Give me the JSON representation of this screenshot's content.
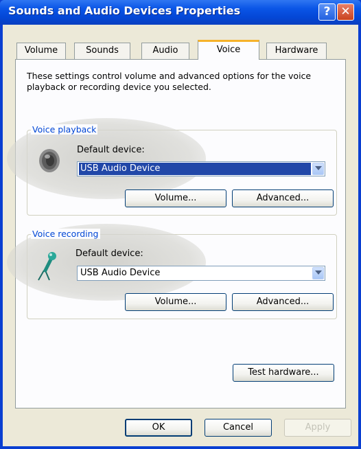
{
  "window": {
    "title": "Sounds and Audio Devices Properties"
  },
  "titlebar": {
    "help_label": "?",
    "close_label": "✕"
  },
  "tabs": [
    {
      "label": "Volume"
    },
    {
      "label": "Sounds"
    },
    {
      "label": "Audio"
    },
    {
      "label": "Voice",
      "active": true
    },
    {
      "label": "Hardware"
    }
  ],
  "description": "These settings control volume and advanced options for the voice playback or recording device you selected.",
  "voice_playback": {
    "group_label": "Voice playback",
    "device_label": "Default device:",
    "device_value": "USB Audio Device",
    "volume_button": "Volume...",
    "advanced_button": "Advanced..."
  },
  "voice_recording": {
    "group_label": "Voice recording",
    "device_label": "Default device:",
    "device_value": "USB Audio Device",
    "volume_button": "Volume...",
    "advanced_button": "Advanced..."
  },
  "test_hardware_button": "Test hardware...",
  "footer": {
    "ok": "OK",
    "cancel": "Cancel",
    "apply": "Apply"
  },
  "colors": {
    "title_bar": "#0a55e6",
    "group_label": "#0046d5",
    "selection": "#2147a8",
    "active_tab_accent": "#f6b22a"
  }
}
